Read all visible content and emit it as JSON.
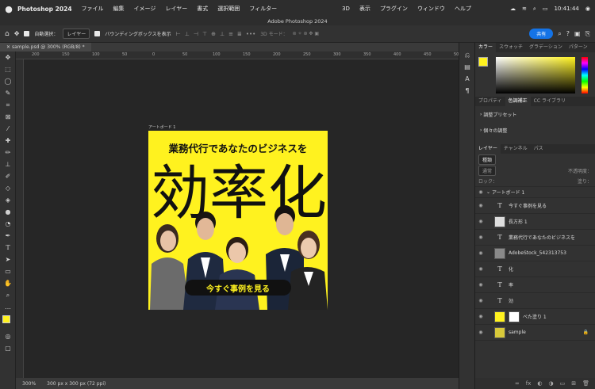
{
  "menubar": {
    "app_name": "Photoshop 2024",
    "items": [
      "ファイル",
      "編集",
      "イメージ",
      "レイヤー",
      "書式",
      "選択範囲",
      "フィルター",
      "3D",
      "表示",
      "プラグイン",
      "ウィンドウ",
      "ヘルプ"
    ],
    "time": "10:41:44"
  },
  "window_title": "Adobe Photoshop 2024",
  "options": {
    "auto_select_label": "自動選択：",
    "auto_select_value": "レイヤー",
    "bbox_label": "バウンディングボックスを表示",
    "mode3d_label": "3D モード：",
    "share_label": "共有"
  },
  "document_tab": "sample.psd @ 300% (RGB/8) *",
  "ruler_ticks": [
    "200",
    "150",
    "100",
    "50",
    "0",
    "50",
    "100",
    "150",
    "200",
    "250",
    "300",
    "350",
    "400",
    "450",
    "500"
  ],
  "artboard": {
    "label": "アートボード 1",
    "headline": "業務代行であなたのビジネスを",
    "big_text": [
      "効",
      "率",
      "化"
    ],
    "cta_label": "今すぐ事例を見る"
  },
  "status": {
    "zoom": "300%",
    "doc_size": "300 px x 300 px (72 ppi)"
  },
  "panels": {
    "color_tabs": [
      "カラー",
      "スウォッチ",
      "グラデーション",
      "パターン"
    ],
    "adjust_tabs": [
      "プロパティ",
      "色調補正",
      "CC ライブラリ"
    ],
    "adjust_items": [
      "調整プリセット",
      "個々の調整"
    ],
    "layer_tabs": [
      "レイヤー",
      "チャンネル",
      "パス"
    ],
    "kind_label": "種類",
    "blend_mode": "通常",
    "opacity_label": "不透明度：",
    "lock_label": "ロック：",
    "fill_label": "塗り：",
    "layers": [
      {
        "name": "アートボード 1",
        "type": "group"
      },
      {
        "name": "今すぐ事例を見る",
        "type": "text"
      },
      {
        "name": "長方形 1",
        "type": "shape"
      },
      {
        "name": "業務代行であなたのビジネスを",
        "type": "text"
      },
      {
        "name": "AdobeStock_542313753",
        "type": "image"
      },
      {
        "name": "化",
        "type": "text"
      },
      {
        "name": "率",
        "type": "text"
      },
      {
        "name": "効",
        "type": "text"
      },
      {
        "name": "ベた塗り 1",
        "type": "fill"
      },
      {
        "name": "sample",
        "type": "image"
      }
    ]
  },
  "colors": {
    "accent": "#1473e6",
    "foreground": "#fff21f",
    "artboard_bg": "#fff21f",
    "cta_bg": "#fff21f"
  }
}
